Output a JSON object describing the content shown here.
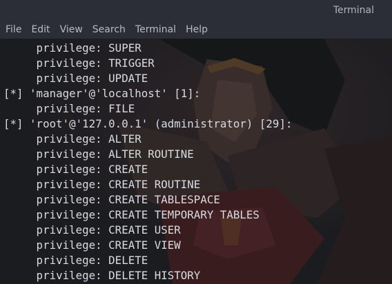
{
  "window": {
    "title": "Terminal"
  },
  "menubar": {
    "items": [
      "File",
      "Edit",
      "View",
      "Search",
      "Terminal",
      "Help"
    ]
  },
  "terminal": {
    "lines": [
      "     privilege: SUPER",
      "     privilege: TRIGGER",
      "     privilege: UPDATE",
      "[*] 'manager'@'localhost' [1]:",
      "     privilege: FILE",
      "[*] 'root'@'127.0.0.1' (administrator) [29]:",
      "     privilege: ALTER",
      "     privilege: ALTER ROUTINE",
      "     privilege: CREATE",
      "     privilege: CREATE ROUTINE",
      "     privilege: CREATE TABLESPACE",
      "     privilege: CREATE TEMPORARY TABLES",
      "     privilege: CREATE USER",
      "     privilege: CREATE VIEW",
      "     privilege: DELETE",
      "     privilege: DELETE HISTORY"
    ]
  },
  "colors": {
    "titlebar": "#2b2e36",
    "terminal_bg": "#1b1c20",
    "terminal_fg": "#d8dbe0"
  },
  "icons": {
    "wallpaper": "wonder-woman-wallpaper"
  }
}
